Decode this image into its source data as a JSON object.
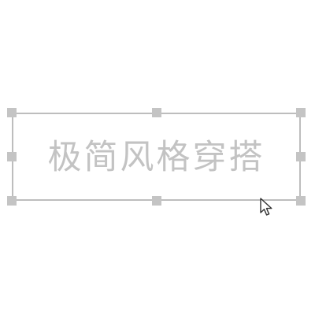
{
  "canvas": {
    "text_element": {
      "text": "极简风格穿搭",
      "text_color": "#c3c3c3"
    },
    "selection": {
      "border_color": "#bdbdbd",
      "handle_color": "#c4c4c4",
      "handles": [
        "top-left",
        "top-middle",
        "top-right",
        "middle-left",
        "middle-right",
        "bottom-left",
        "bottom-middle",
        "bottom-right"
      ]
    },
    "cursor": {
      "icon": "mouse-pointer-icon"
    }
  }
}
